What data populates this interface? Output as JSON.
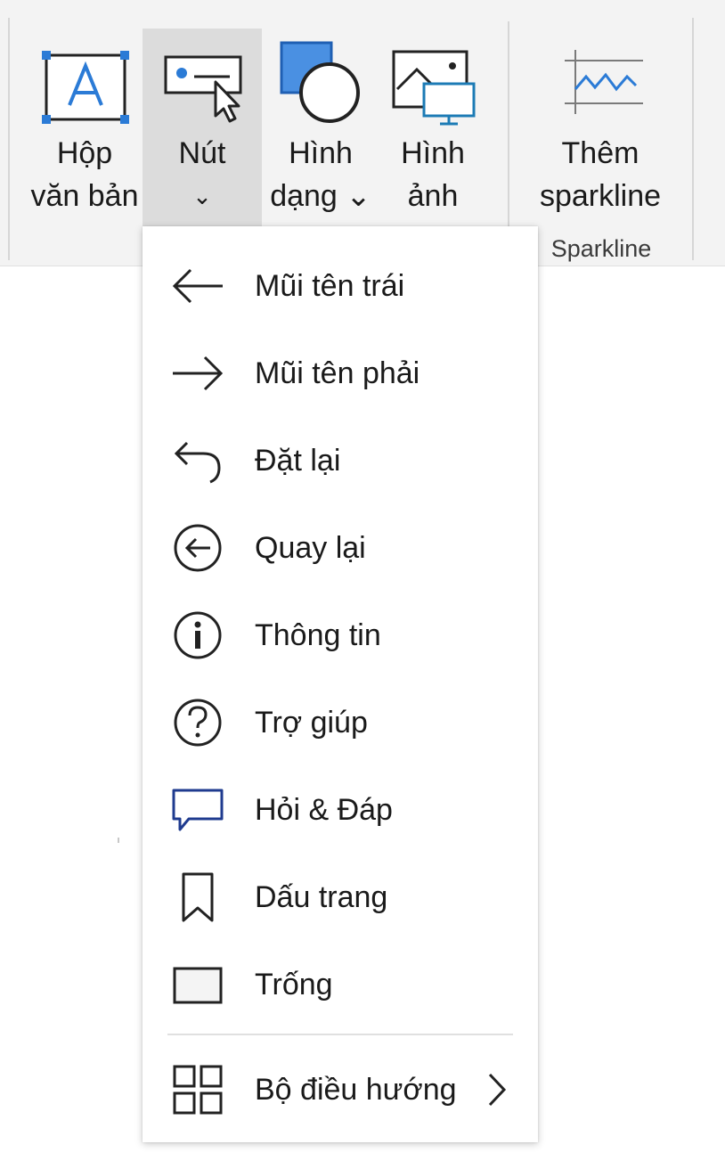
{
  "ribbon": {
    "buttons": {
      "text_box": {
        "line1": "Hộp",
        "line2": "văn bản"
      },
      "button": {
        "line1": "Nút",
        "line2": "⌄"
      },
      "shapes": {
        "line1": "Hình",
        "line2": "dạng ⌄"
      },
      "images": {
        "line1": "Hình",
        "line2": "ảnh"
      },
      "add_sparkline": {
        "line1": "Thêm",
        "line2": "sparkline"
      }
    },
    "group_label": "Sparkline"
  },
  "menu": {
    "items": [
      {
        "label": "Mũi tên trái",
        "icon": "arrow-left-icon"
      },
      {
        "label": "Mũi tên phải",
        "icon": "arrow-right-icon"
      },
      {
        "label": "Đặt lại",
        "icon": "reset-icon"
      },
      {
        "label": "Quay lại",
        "icon": "back-circle-icon"
      },
      {
        "label": "Thông tin",
        "icon": "info-icon"
      },
      {
        "label": "Trợ giúp",
        "icon": "help-icon"
      },
      {
        "label": "Hỏi & Đáp",
        "icon": "chat-bubble-icon"
      },
      {
        "label": "Dấu trang",
        "icon": "bookmark-icon"
      },
      {
        "label": "Trống",
        "icon": "blank-icon"
      }
    ],
    "navigator": {
      "label": "Bộ điều hướng",
      "icon": "navigator-grid-icon"
    }
  },
  "colors": {
    "accent_blue": "#2b7bd6",
    "dark_blue": "#1f3b8f",
    "ribbon_bg": "#f3f3f3",
    "active_bg": "#dcdcdc"
  }
}
